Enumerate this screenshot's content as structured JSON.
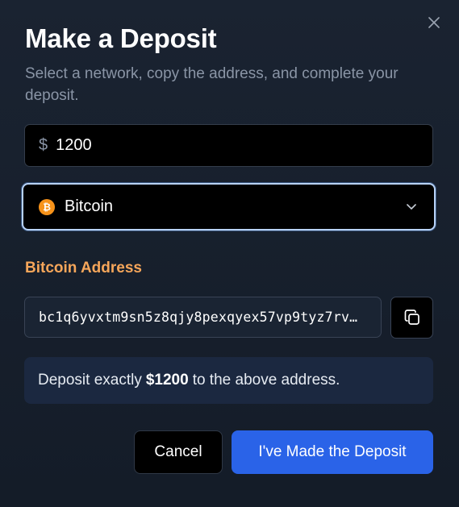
{
  "dialog": {
    "title": "Make a Deposit",
    "subtitle": "Select a network, copy the address, and complete your deposit.",
    "close_icon": "close-icon"
  },
  "amount": {
    "currency_symbol": "$",
    "value": "1200"
  },
  "network": {
    "selected": "Bitcoin",
    "icon": "bitcoin-icon",
    "icon_glyph": "₿",
    "icon_color": "#f7931a"
  },
  "address": {
    "label": "Bitcoin Address",
    "value": "bc1q6yvxtm9sn5z8qjy8pexqyex57vp9tyz7rv…",
    "copy_icon": "copy-icon"
  },
  "notice": {
    "prefix": "Deposit exactly",
    "amount": "$1200",
    "suffix": "to the above address."
  },
  "actions": {
    "cancel_label": "Cancel",
    "confirm_label": "I've Made the Deposit"
  },
  "colors": {
    "accent": "#2a63e8",
    "address_label": "#f6a65a",
    "focus_ring": "#b8d2f6"
  }
}
